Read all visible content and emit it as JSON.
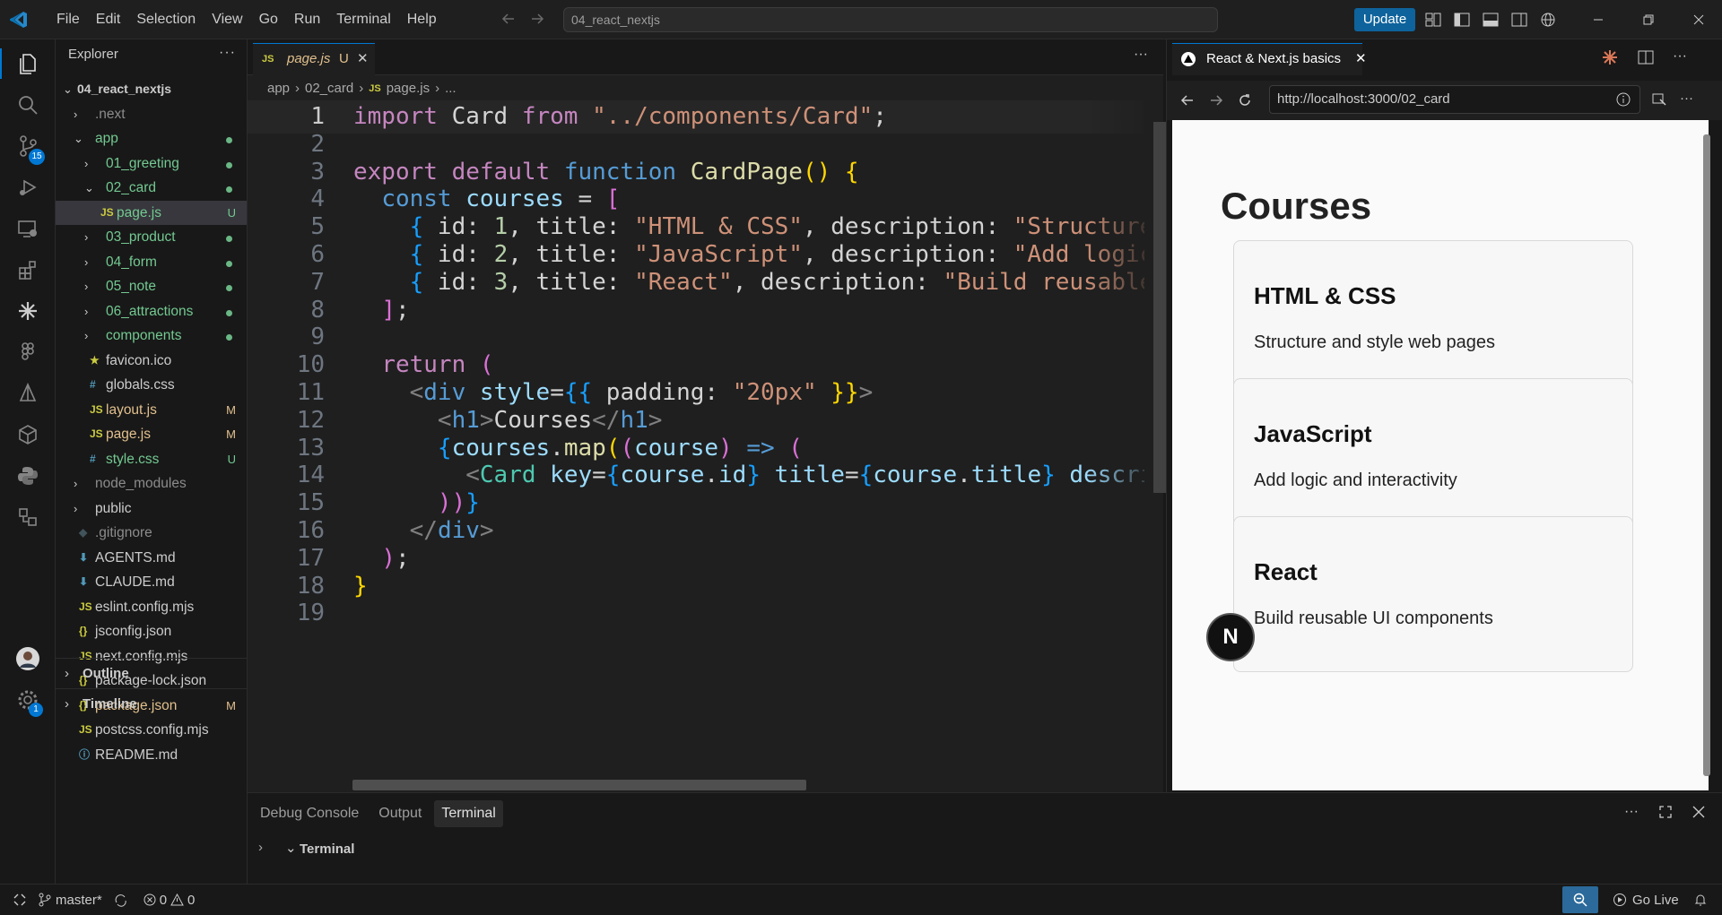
{
  "window": {
    "menus": [
      "File",
      "Edit",
      "Selection",
      "View",
      "Go",
      "Run",
      "Terminal",
      "Help"
    ],
    "command_center": "04_react_nextjs",
    "update_label": "Update"
  },
  "activity": {
    "source_control_badge": "15",
    "settings_badge": "1"
  },
  "sidebar": {
    "title": "Explorer",
    "root": "04_react_nextjs",
    "items": [
      {
        "label": ".next",
        "kind": "folder",
        "depth": 1,
        "open": false,
        "color": "#8c8c8c",
        "status": ""
      },
      {
        "label": "app",
        "kind": "folder",
        "depth": 1,
        "open": true,
        "color": "#73c991",
        "status": "dot"
      },
      {
        "label": "01_greeting",
        "kind": "folder",
        "depth": 2,
        "open": false,
        "color": "#73c991",
        "status": "dot"
      },
      {
        "label": "02_card",
        "kind": "folder",
        "depth": 2,
        "open": true,
        "color": "#73c991",
        "status": "dot"
      },
      {
        "label": "page.js",
        "kind": "js",
        "depth": 3,
        "color": "#73c991",
        "status": "U",
        "selected": true
      },
      {
        "label": "03_product",
        "kind": "folder",
        "depth": 2,
        "open": false,
        "color": "#73c991",
        "status": "dot"
      },
      {
        "label": "04_form",
        "kind": "folder",
        "depth": 2,
        "open": false,
        "color": "#73c991",
        "status": "dot"
      },
      {
        "label": "05_note",
        "kind": "folder",
        "depth": 2,
        "open": false,
        "color": "#73c991",
        "status": "dot"
      },
      {
        "label": "06_attractions",
        "kind": "folder",
        "depth": 2,
        "open": false,
        "color": "#73c991",
        "status": "dot"
      },
      {
        "label": "components",
        "kind": "folder",
        "depth": 2,
        "open": false,
        "color": "#73c991",
        "status": "dot"
      },
      {
        "label": "favicon.ico",
        "kind": "ico",
        "depth": 2,
        "color": "#cccccc",
        "status": ""
      },
      {
        "label": "globals.css",
        "kind": "css",
        "depth": 2,
        "color": "#cccccc",
        "status": ""
      },
      {
        "label": "layout.js",
        "kind": "js",
        "depth": 2,
        "color": "#e2c08d",
        "status": "M"
      },
      {
        "label": "page.js",
        "kind": "js",
        "depth": 2,
        "color": "#e2c08d",
        "status": "M"
      },
      {
        "label": "style.css",
        "kind": "css",
        "depth": 2,
        "color": "#73c991",
        "status": "U"
      },
      {
        "label": "node_modules",
        "kind": "folder",
        "depth": 1,
        "open": false,
        "color": "#8c8c8c",
        "status": ""
      },
      {
        "label": "public",
        "kind": "folder",
        "depth": 1,
        "open": false,
        "color": "#cccccc",
        "status": ""
      },
      {
        "label": ".gitignore",
        "kind": "git",
        "depth": 1,
        "color": "#8c8c8c",
        "status": ""
      },
      {
        "label": "AGENTS.md",
        "kind": "md",
        "depth": 1,
        "color": "#cccccc",
        "status": ""
      },
      {
        "label": "CLAUDE.md",
        "kind": "md",
        "depth": 1,
        "color": "#cccccc",
        "status": ""
      },
      {
        "label": "eslint.config.mjs",
        "kind": "js",
        "depth": 1,
        "color": "#cccccc",
        "status": ""
      },
      {
        "label": "jsconfig.json",
        "kind": "json",
        "depth": 1,
        "color": "#cccccc",
        "status": ""
      },
      {
        "label": "next.config.mjs",
        "kind": "js",
        "depth": 1,
        "color": "#cccccc",
        "status": ""
      },
      {
        "label": "package-lock.json",
        "kind": "json",
        "depth": 1,
        "color": "#cccccc",
        "status": ""
      },
      {
        "label": "package.json",
        "kind": "json",
        "depth": 1,
        "color": "#e2c08d",
        "status": "M"
      },
      {
        "label": "postcss.config.mjs",
        "kind": "js",
        "depth": 1,
        "color": "#cccccc",
        "status": ""
      },
      {
        "label": "README.md",
        "kind": "info",
        "depth": 1,
        "color": "#cccccc",
        "status": ""
      }
    ],
    "outline": "Outline",
    "timeline": "Timeline"
  },
  "editor": {
    "tab": {
      "icon": "JS",
      "name": "page.js",
      "status": "U"
    },
    "breadcrumb": [
      "app",
      "02_card",
      "page.js",
      "..."
    ],
    "lines": [
      [
        [
          "kw",
          "import"
        ],
        [
          "pu",
          " Card "
        ],
        [
          "kw",
          "from"
        ],
        [
          "pu",
          " "
        ],
        [
          "st",
          "\"../components/Card\""
        ],
        [
          "pu",
          ";"
        ]
      ],
      [],
      [
        [
          "kw",
          "export"
        ],
        [
          "pu",
          " "
        ],
        [
          "kw",
          "default"
        ],
        [
          "pu",
          " "
        ],
        [
          "kw2",
          "function"
        ],
        [
          "pu",
          " "
        ],
        [
          "fn",
          "CardPage"
        ],
        [
          "br1",
          "()"
        ],
        [
          "pu",
          " "
        ],
        [
          "br1",
          "{"
        ]
      ],
      [
        [
          "pu",
          "  "
        ],
        [
          "kw2",
          "const"
        ],
        [
          "pu",
          " "
        ],
        [
          "var",
          "courses"
        ],
        [
          "pu",
          " = "
        ],
        [
          "br2",
          "["
        ]
      ],
      [
        [
          "pu",
          "    "
        ],
        [
          "br3",
          "{"
        ],
        [
          "pu",
          " id: "
        ],
        [
          "num",
          "1"
        ],
        [
          "pu",
          ", title: "
        ],
        [
          "st",
          "\"HTML & CSS\""
        ],
        [
          "pu",
          ", description: "
        ],
        [
          "st",
          "\"Structure and style web pages\""
        ],
        [
          "pu",
          " "
        ],
        [
          "br3",
          "}"
        ],
        [
          "pu",
          ","
        ]
      ],
      [
        [
          "pu",
          "    "
        ],
        [
          "br3",
          "{"
        ],
        [
          "pu",
          " id: "
        ],
        [
          "num",
          "2"
        ],
        [
          "pu",
          ", title: "
        ],
        [
          "st",
          "\"JavaScript\""
        ],
        [
          "pu",
          ", description: "
        ],
        [
          "st",
          "\"Add logic and interactivity\""
        ],
        [
          "pu",
          " "
        ],
        [
          "br3",
          "}"
        ],
        [
          "pu",
          ","
        ]
      ],
      [
        [
          "pu",
          "    "
        ],
        [
          "br3",
          "{"
        ],
        [
          "pu",
          " id: "
        ],
        [
          "num",
          "3"
        ],
        [
          "pu",
          ", title: "
        ],
        [
          "st",
          "\"React\""
        ],
        [
          "pu",
          ", description: "
        ],
        [
          "st",
          "\"Build reusable UI components\""
        ],
        [
          "pu",
          " "
        ],
        [
          "br3",
          "}"
        ],
        [
          "pu",
          ","
        ]
      ],
      [
        [
          "pu",
          "  "
        ],
        [
          "br2",
          "]"
        ],
        [
          "pu",
          ";"
        ]
      ],
      [],
      [
        [
          "pu",
          "  "
        ],
        [
          "kw",
          "return"
        ],
        [
          "pu",
          " "
        ],
        [
          "br2",
          "("
        ]
      ],
      [
        [
          "pu",
          "    "
        ],
        [
          "gr",
          "<"
        ],
        [
          "tag",
          "div"
        ],
        [
          "pu",
          " "
        ],
        [
          "var",
          "style"
        ],
        [
          "pu",
          "="
        ],
        [
          "br3",
          "{{"
        ],
        [
          "pu",
          " padding: "
        ],
        [
          "st",
          "\"20px\""
        ],
        [
          "pu",
          " "
        ],
        [
          "br1",
          "}}"
        ],
        [
          "gr",
          ">"
        ]
      ],
      [
        [
          "pu",
          "      "
        ],
        [
          "gr",
          "<"
        ],
        [
          "tag",
          "h1"
        ],
        [
          "gr",
          ">"
        ],
        [
          "pu",
          "Courses"
        ],
        [
          "gr",
          "</"
        ],
        [
          "tag",
          "h1"
        ],
        [
          "gr",
          ">"
        ]
      ],
      [
        [
          "pu",
          "      "
        ],
        [
          "br3",
          "{"
        ],
        [
          "var",
          "courses"
        ],
        [
          "pu",
          "."
        ],
        [
          "fn",
          "map"
        ],
        [
          "br1",
          "("
        ],
        [
          "br2",
          "("
        ],
        [
          "var",
          "course"
        ],
        [
          "br2",
          ")"
        ],
        [
          "pu",
          " "
        ],
        [
          "kw2",
          "=>"
        ],
        [
          "pu",
          " "
        ],
        [
          "br2",
          "("
        ]
      ],
      [
        [
          "pu",
          "        "
        ],
        [
          "gr",
          "<"
        ],
        [
          "cmp",
          "Card"
        ],
        [
          "pu",
          " "
        ],
        [
          "var",
          "key"
        ],
        [
          "pu",
          "="
        ],
        [
          "br3",
          "{"
        ],
        [
          "var",
          "course"
        ],
        [
          "pu",
          "."
        ],
        [
          "var",
          "id"
        ],
        [
          "br3",
          "}"
        ],
        [
          "pu",
          " "
        ],
        [
          "var",
          "title"
        ],
        [
          "pu",
          "="
        ],
        [
          "br3",
          "{"
        ],
        [
          "var",
          "course"
        ],
        [
          "pu",
          "."
        ],
        [
          "var",
          "title"
        ],
        [
          "br3",
          "}"
        ],
        [
          "pu",
          " "
        ],
        [
          "var",
          "description"
        ],
        [
          "pu",
          "="
        ],
        [
          "br3",
          "{"
        ],
        [
          "var",
          "course"
        ],
        [
          "pu",
          "."
        ],
        [
          "var",
          "description"
        ],
        [
          "br3",
          "}"
        ],
        [
          "pu",
          " "
        ],
        [
          "gr",
          "/>"
        ]
      ],
      [
        [
          "pu",
          "      "
        ],
        [
          "br2",
          "))"
        ],
        [
          "br3",
          "}"
        ]
      ],
      [
        [
          "pu",
          "    "
        ],
        [
          "gr",
          "</"
        ],
        [
          "tag",
          "div"
        ],
        [
          "gr",
          ">"
        ]
      ],
      [
        [
          "pu",
          "  "
        ],
        [
          "br2",
          ")"
        ],
        [
          "pu",
          ";"
        ]
      ],
      [
        [
          "br1",
          "}"
        ]
      ],
      []
    ]
  },
  "browser": {
    "tab_title": "React & Next.js basics",
    "url": "http://localhost:3000/02_card",
    "page": {
      "heading": "Courses",
      "cards": [
        {
          "title": "HTML & CSS",
          "description": "Structure and style web pages"
        },
        {
          "title": "JavaScript",
          "description": "Add logic and interactivity"
        },
        {
          "title": "React",
          "description": "Build reusable UI components"
        }
      ],
      "next_badge": "N"
    }
  },
  "panel": {
    "tabs": [
      "Debug Console",
      "Output",
      "Terminal"
    ],
    "active_tab": "Terminal",
    "terminal_section": "Terminal"
  },
  "statusbar": {
    "branch": "master*",
    "errors": "0",
    "warnings": "0",
    "go_live": "Go Live"
  }
}
